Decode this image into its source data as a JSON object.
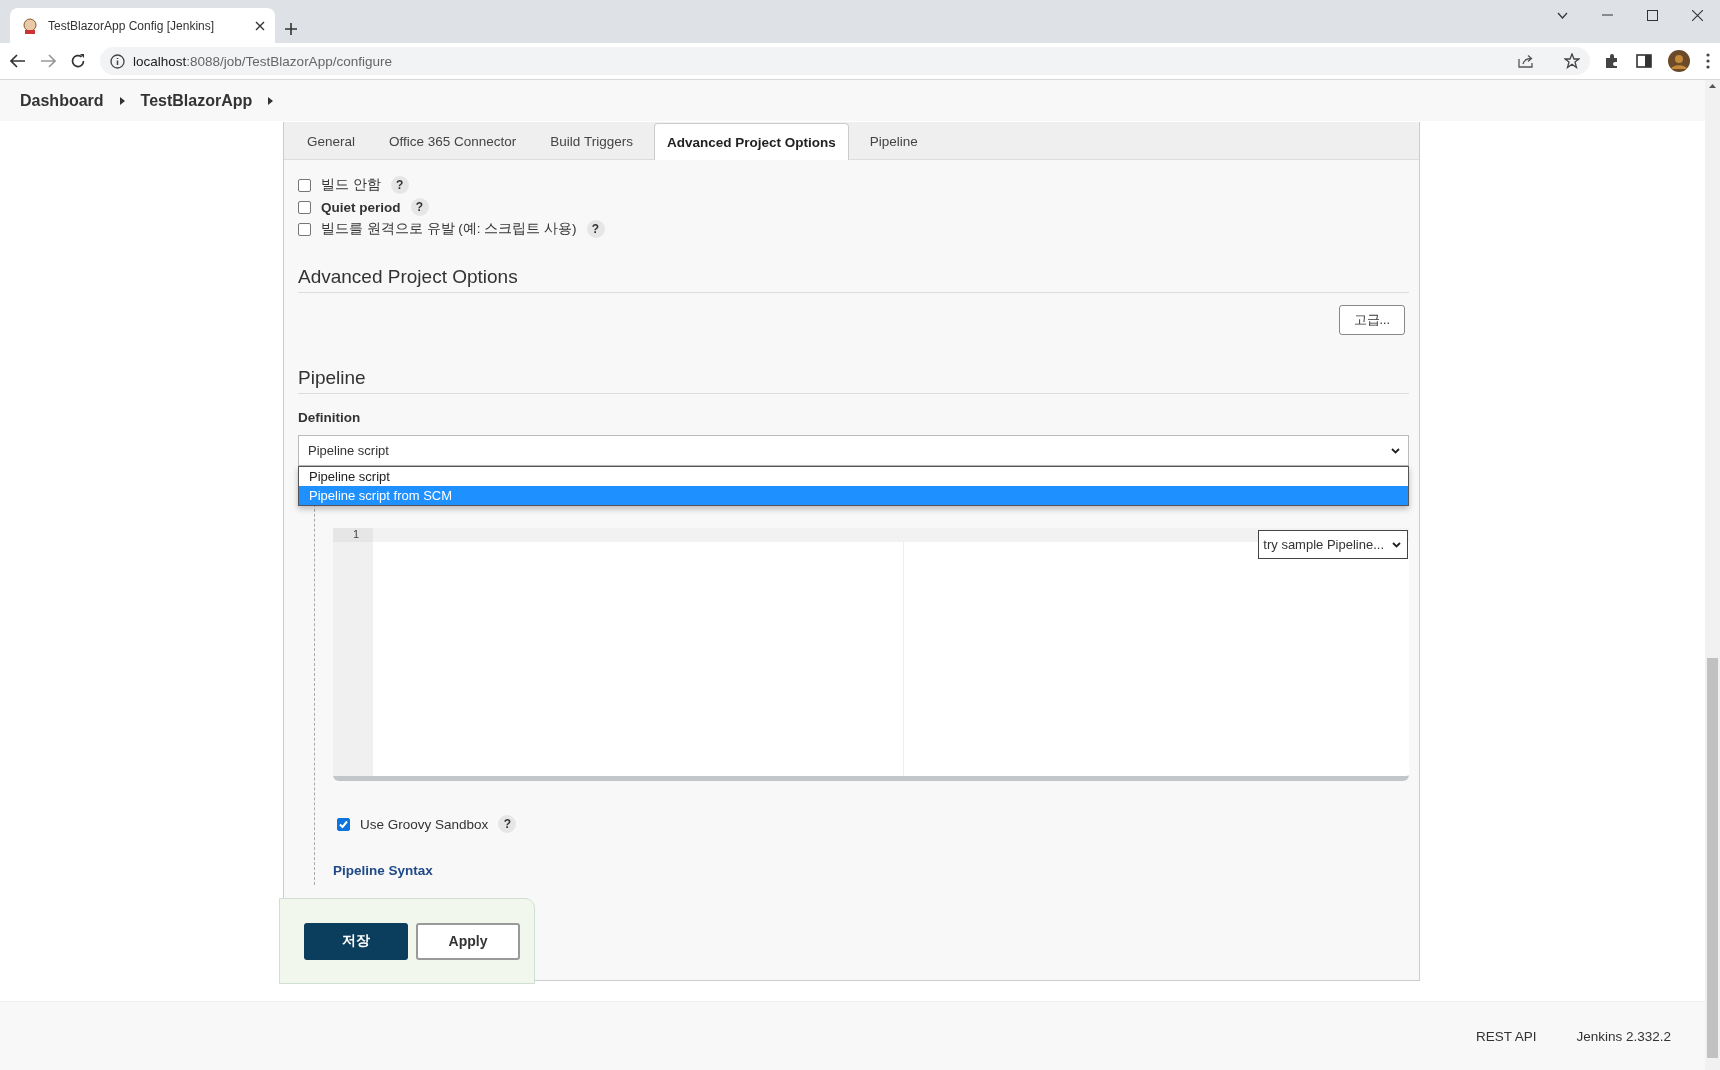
{
  "browser": {
    "tab_title": "TestBlazorApp Config [Jenkins]",
    "url_host": "localhost",
    "url_path": ":8088/job/TestBlazorApp/configure"
  },
  "breadcrumb": [
    "Dashboard",
    "TestBlazorApp"
  ],
  "tabs": [
    {
      "label": "General",
      "selected": false
    },
    {
      "label": "Office 365 Connector",
      "selected": false
    },
    {
      "label": "Build Triggers",
      "selected": false
    },
    {
      "label": "Advanced Project Options",
      "selected": true
    },
    {
      "label": "Pipeline",
      "selected": false
    }
  ],
  "options": [
    {
      "label": "빌드 안함",
      "bold": false,
      "checked": false,
      "help": "?"
    },
    {
      "label": "Quiet period",
      "bold": true,
      "checked": false,
      "help": "?"
    },
    {
      "label": "빌드를 원격으로 유발 (예: 스크립트 사용)",
      "bold": false,
      "checked": false,
      "help": "?"
    }
  ],
  "advanced_section": {
    "title": "Advanced Project Options",
    "advanced_button": "고급..."
  },
  "pipeline": {
    "title": "Pipeline",
    "definition_label": "Definition",
    "definition_value": "Pipeline script",
    "definition_options": [
      {
        "label": "Pipeline script",
        "selected": false
      },
      {
        "label": "Pipeline script from SCM",
        "selected": true
      }
    ],
    "editor": {
      "line_numbers": [
        "1"
      ],
      "sample_select": "try sample Pipeline..."
    },
    "sandbox": {
      "label": "Use Groovy Sandbox",
      "checked": true,
      "help": "?"
    },
    "syntax_link": "Pipeline Syntax"
  },
  "buttons": [
    {
      "label": "저장",
      "kind": "primary"
    },
    {
      "label": "Apply",
      "kind": "secondary"
    }
  ],
  "footer": [
    "REST API",
    "Jenkins 2.332.2"
  ]
}
